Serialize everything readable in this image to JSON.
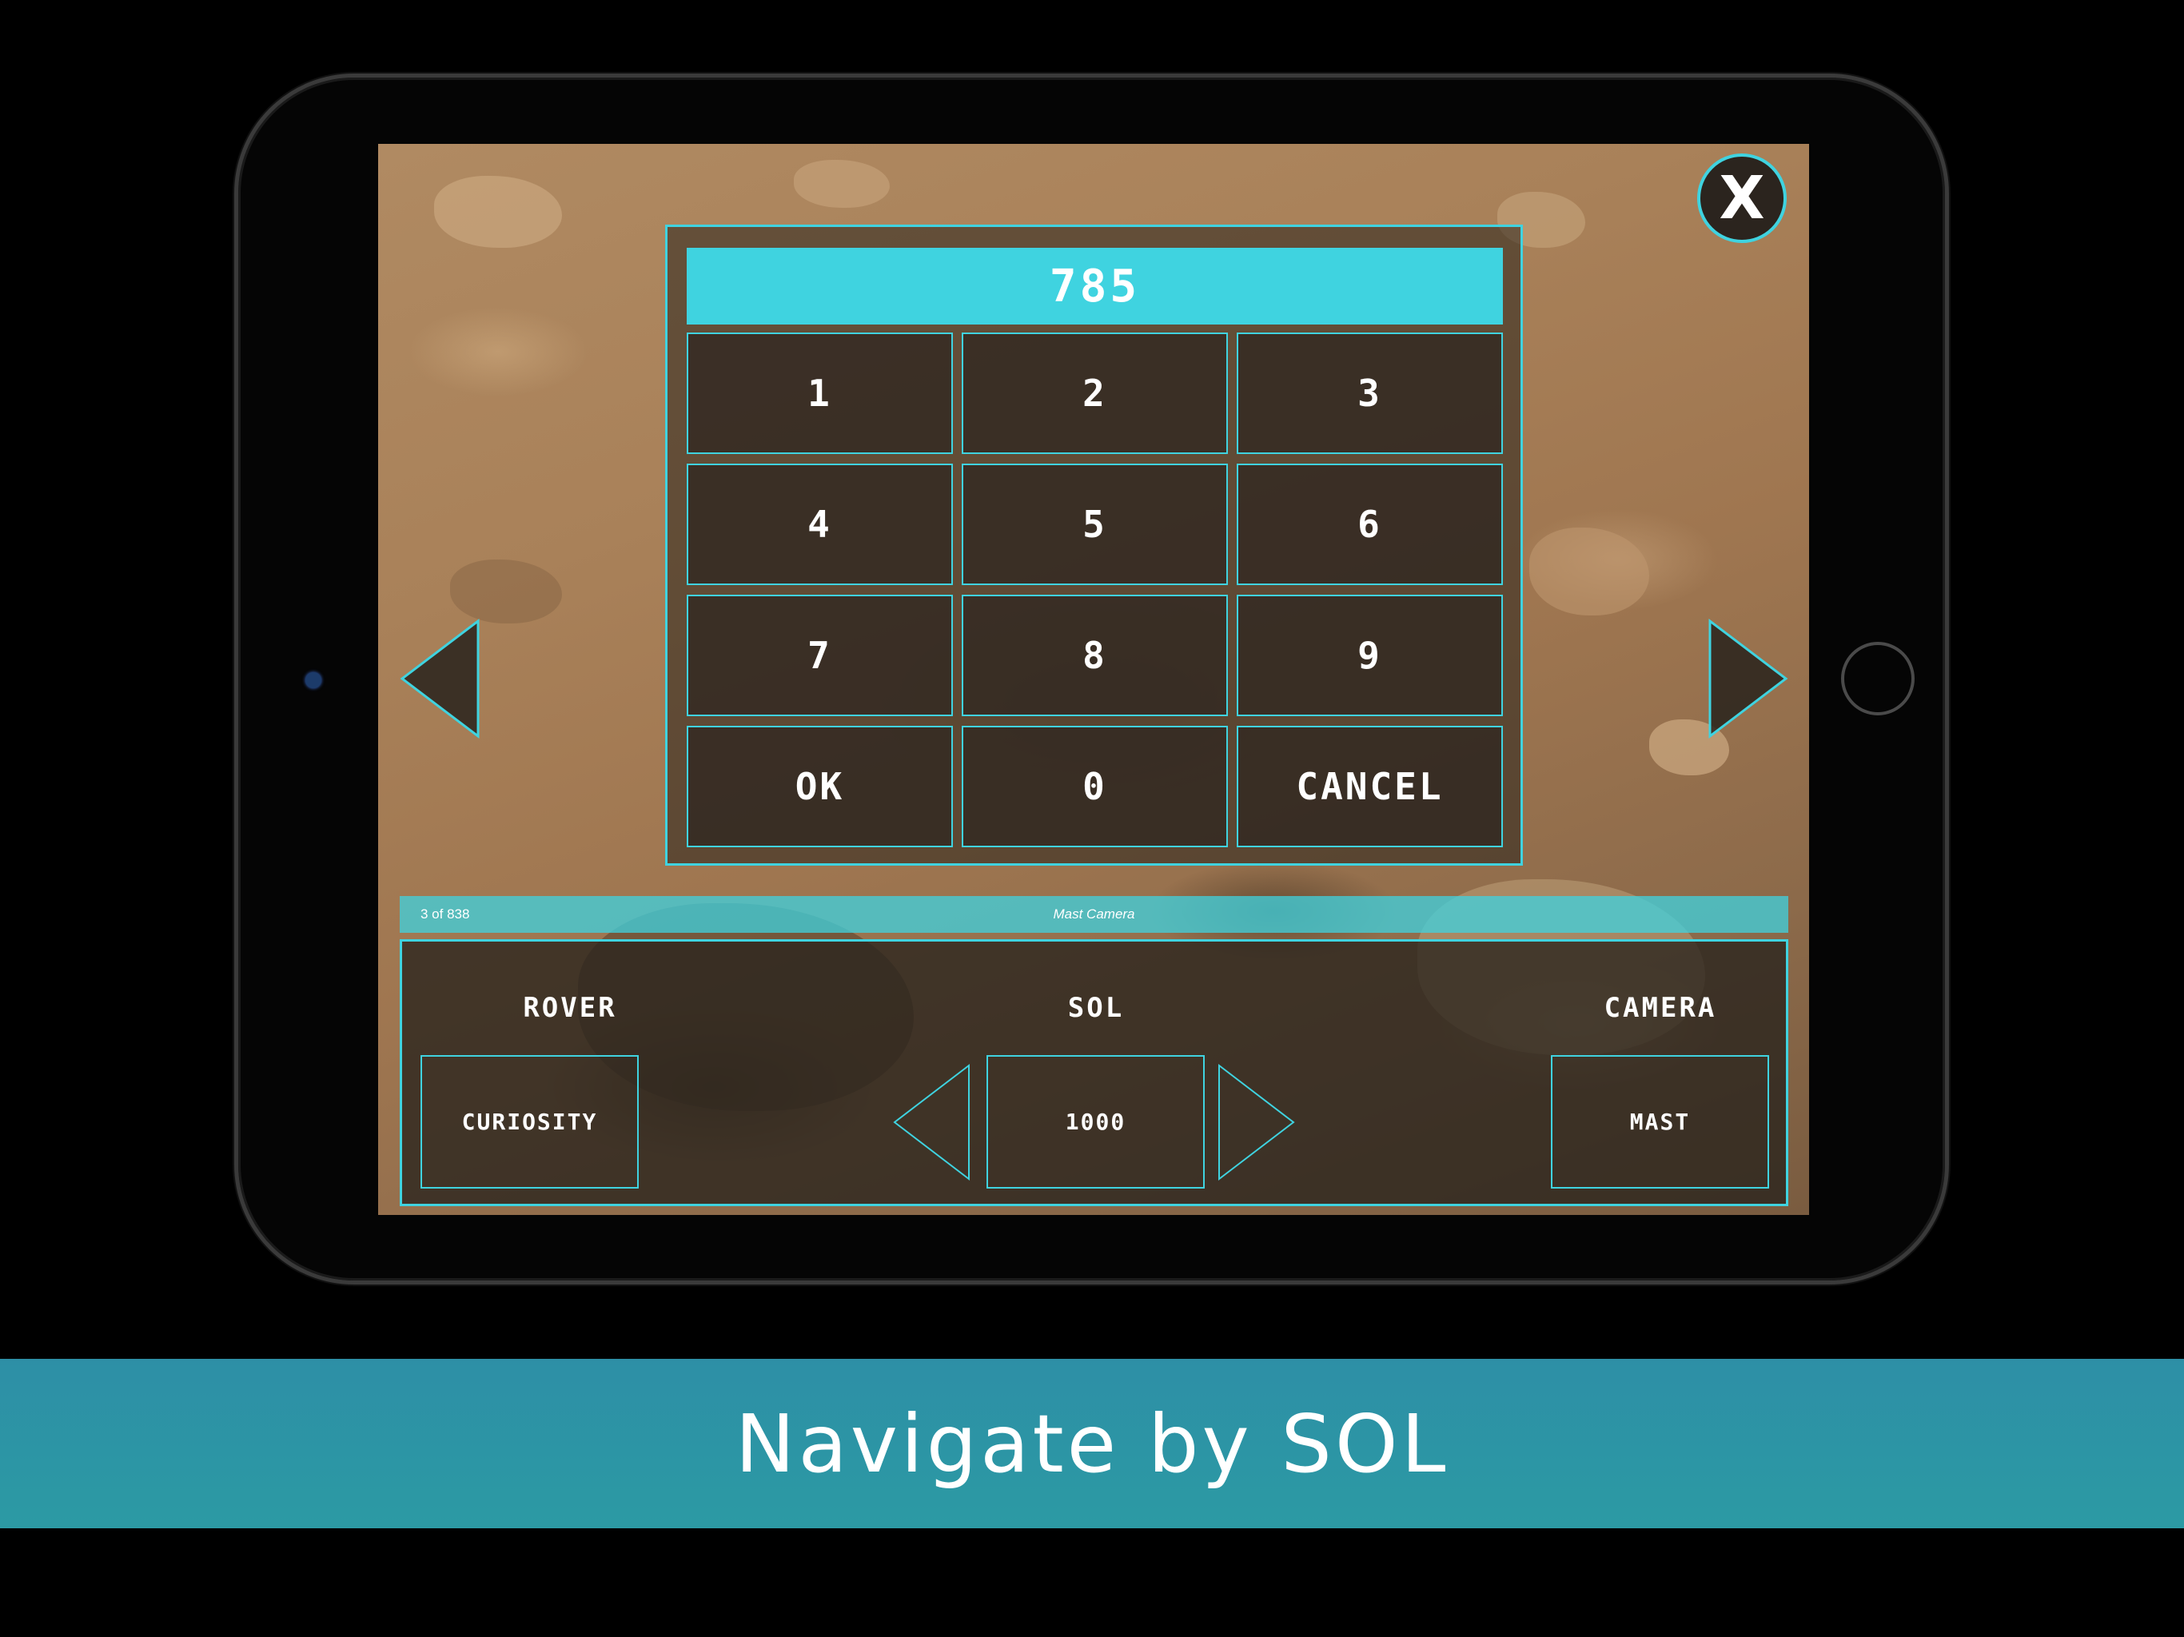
{
  "keypad": {
    "display_value": "785",
    "keys": [
      "1",
      "2",
      "3",
      "4",
      "5",
      "6",
      "7",
      "8",
      "9",
      "OK",
      "0",
      "CANCEL"
    ]
  },
  "close": {
    "symbol": "X"
  },
  "info_bar": {
    "count": "3 of 838",
    "camera_name": "Mast Camera"
  },
  "controls": {
    "rover_label": "ROVER",
    "rover_value": "CURIOSITY",
    "sol_label": "SOL",
    "sol_value": "1000",
    "camera_label": "CAMERA",
    "camera_value": "MAST"
  },
  "caption": "Navigate by SOL",
  "colors": {
    "accent": "#3fd3e0",
    "banner": "#2c9aa4",
    "panel": "#2d261f"
  },
  "icons": [
    "close-icon",
    "previous-arrow-icon",
    "next-arrow-icon",
    "sol-decrease-arrow-icon",
    "sol-increase-arrow-icon"
  ]
}
